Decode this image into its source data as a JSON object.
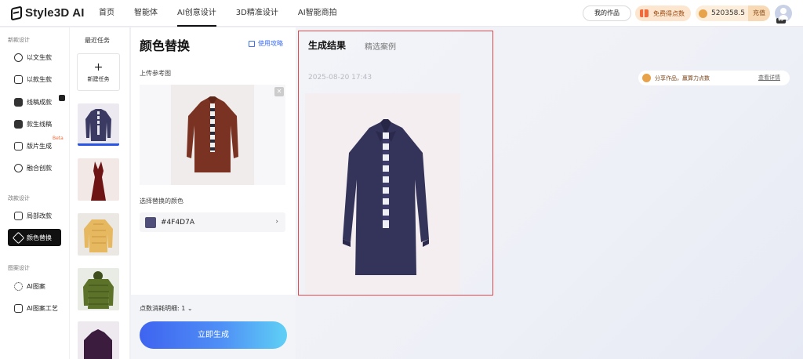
{
  "app": {
    "logo": "Style3D AI"
  },
  "nav": [
    "首页",
    "智能体",
    "AI创意设计",
    "3D精准设计",
    "AI智能商拍"
  ],
  "top_actions": {
    "my_works": "我的作品",
    "free_points": "免费得点数",
    "credits": "520358.5",
    "recharge": "充值",
    "vip": "VIP"
  },
  "sidebar": {
    "sections": [
      {
        "label": "新款设计",
        "items": [
          "以文生款",
          "以款生款",
          "线稿成款",
          "款生线稿",
          "版片生成",
          "融合创款"
        ]
      },
      {
        "label": "改款设计",
        "items": [
          "局部改款",
          "颜色替换"
        ]
      },
      {
        "label": "图案设计",
        "items": [
          "AI图案",
          "AI图案工艺"
        ]
      }
    ],
    "beta_badge": "Beta",
    "active_item": "颜色替换"
  },
  "tasks": {
    "title": "最近任务",
    "new_task": "新建任务"
  },
  "panel": {
    "title": "颜色替换",
    "guide_link": "使用攻略",
    "upload_label": "上传参考图",
    "color_label": "选择替换的颜色",
    "color_hex": "#4F4D7A",
    "cost_label": "点数消耗明细: 1",
    "generate_button": "立即生成"
  },
  "result": {
    "tabs": [
      "生成结果",
      "精选案例"
    ],
    "timestamp": "2025-08-20 17:43",
    "share_text": "分享作品，赢算力点数",
    "share_link": "查看详情"
  },
  "colors": {
    "accent_blue": "#3d6ef5",
    "highlight_red": "#e5484d",
    "selected_color": "#4F4D7A",
    "reference_shirt": "#7a3322"
  }
}
